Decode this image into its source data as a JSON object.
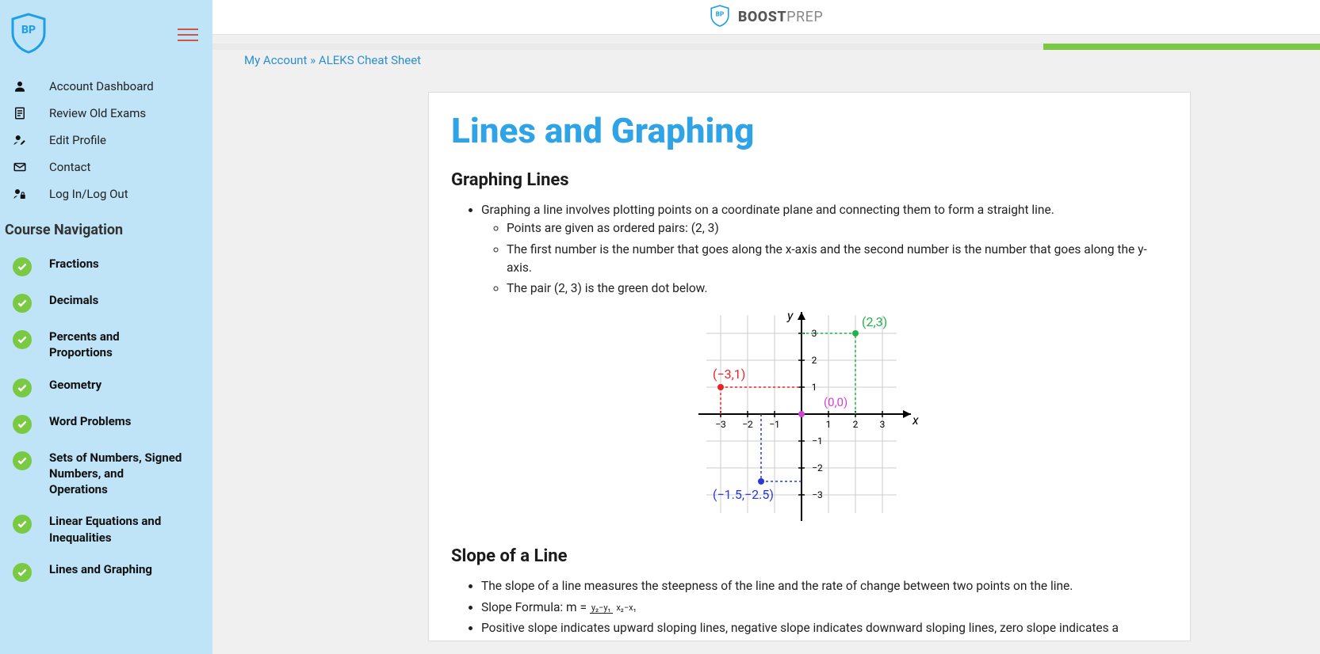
{
  "brand": {
    "boost": "BOOST",
    "prep": "PREP"
  },
  "breadcrumb": {
    "acct": "My Account",
    "sep": " » ",
    "page": "ALEKS Cheat Sheet"
  },
  "sidebar": {
    "nav": [
      {
        "label": "Account Dashboard"
      },
      {
        "label": "Review Old Exams"
      },
      {
        "label": "Edit Profile"
      },
      {
        "label": "Contact"
      },
      {
        "label": "Log In/Log Out"
      }
    ],
    "heading": "Course Navigation",
    "course": [
      {
        "label": "Fractions"
      },
      {
        "label": "Decimals"
      },
      {
        "label": "Percents and Proportions"
      },
      {
        "label": "Geometry"
      },
      {
        "label": "Word Problems"
      },
      {
        "label": "Sets of Numbers, Signed Numbers, and Operations"
      },
      {
        "label": "Linear Equations and Inequalities"
      },
      {
        "label": "Lines and Graphing"
      }
    ]
  },
  "content": {
    "h1": "Lines and Graphing",
    "sec1": {
      "h2": "Graphing Lines",
      "li1": "Graphing a line involves plotting points on a coordinate plane and connecting them to form a straight line.",
      "li1a": "Points are given as ordered pairs: (2, 3)",
      "li1b": "The first number is the number that goes along the x-axis and the second number is the number that goes along the y-axis.",
      "li1c": "The pair (2, 3) is the green dot below."
    },
    "sec2": {
      "h2": "Slope of a Line",
      "li1": "The slope of a line measures the steepness of the line and the rate of change between two points on the line.",
      "li2_prefix": "Slope Formula: m = ",
      "li2_num": "y₂−y₁",
      "li2_den": "x₂−x₁",
      "li3": "Positive slope indicates upward sloping lines, negative slope indicates downward sloping lines, zero slope indicates a horizontal line, and undefined slope indicates a vertical line."
    }
  },
  "graph": {
    "xlabel": "x",
    "ylabel": "y",
    "origin_label": "(0,0)",
    "points": [
      {
        "x": 2,
        "y": 3,
        "label": "(2,3)",
        "color": "#1fb24a"
      },
      {
        "x": -3,
        "y": 1,
        "label": "(−3,1)",
        "color": "#e22"
      },
      {
        "x": -1.5,
        "y": -2.5,
        "label": "(−1.5,−2.5)",
        "color": "#2938d8"
      }
    ],
    "ticks": [
      -3,
      -2,
      -1,
      1,
      2,
      3
    ],
    "tick_text": {
      "n3": "−3",
      "n2": "−2",
      "n1": "−1",
      "p1": "1",
      "p2": "2",
      "p3": "3"
    }
  },
  "progress": {
    "percent_remaining": 25
  }
}
